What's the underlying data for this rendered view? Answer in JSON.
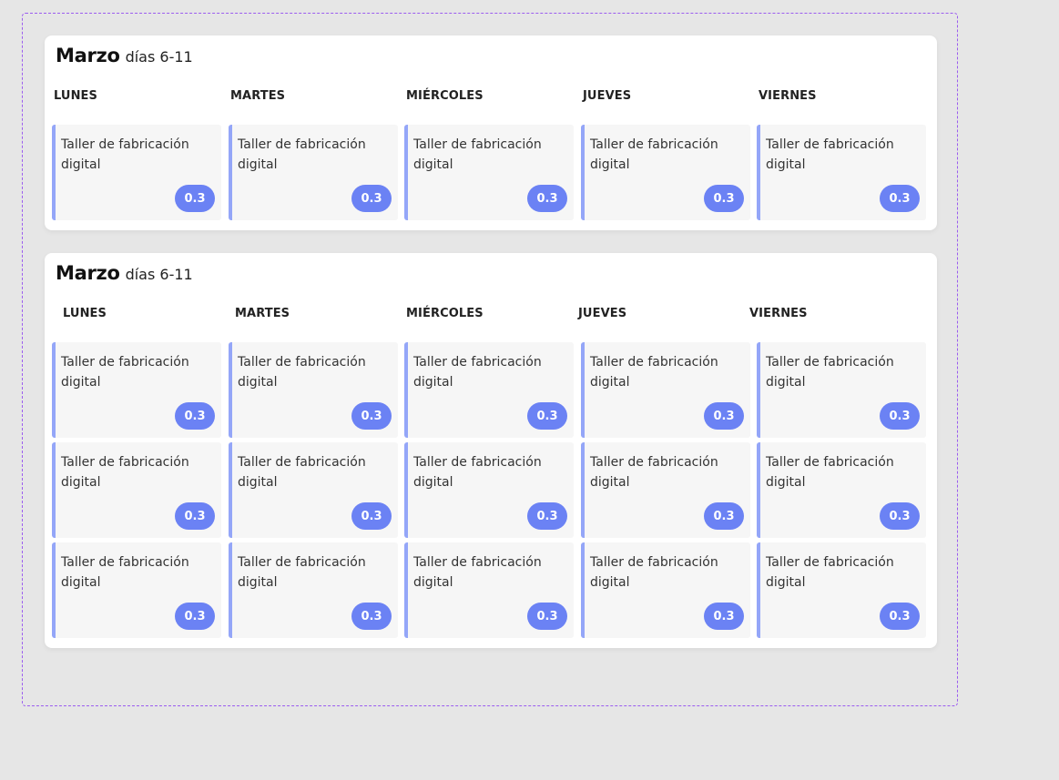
{
  "weeks": [
    {
      "month": "Marzo",
      "range": "días 6-11",
      "days": [
        "LUNES",
        "MARTES",
        "MIÉRCOLES",
        "JUEVES",
        "VIERNES"
      ],
      "rows": [
        [
          {
            "title": "Taller de fabricación digital",
            "badge": "0.3"
          },
          {
            "title": "Taller de fabricación digital",
            "badge": "0.3"
          },
          {
            "title": "Taller de fabricación digital",
            "badge": "0.3"
          },
          {
            "title": "Taller de fabricación digital",
            "badge": "0.3"
          },
          {
            "title": "Taller de fabricación digital",
            "badge": "0.3"
          }
        ]
      ]
    },
    {
      "month": "Marzo",
      "range": "días 6-11",
      "days": [
        "LUNES",
        "MARTES",
        "MIÉRCOLES",
        "JUEVES",
        "VIERNES"
      ],
      "rows": [
        [
          {
            "title": "Taller de fabricación digital",
            "badge": "0.3"
          },
          {
            "title": "Taller de fabricación digital",
            "badge": "0.3"
          },
          {
            "title": "Taller de fabricación digital",
            "badge": "0.3"
          },
          {
            "title": "Taller de fabricación digital",
            "badge": "0.3"
          },
          {
            "title": "Taller de fabricación digital",
            "badge": "0.3"
          }
        ],
        [
          {
            "title": "Taller de fabricación digital",
            "badge": "0.3"
          },
          {
            "title": "Taller de fabricación digital",
            "badge": "0.3"
          },
          {
            "title": "Taller de fabricación digital",
            "badge": "0.3"
          },
          {
            "title": "Taller de fabricación digital",
            "badge": "0.3"
          },
          {
            "title": "Taller de fabricación digital",
            "badge": "0.3"
          }
        ],
        [
          {
            "title": "Taller de fabricación digital",
            "badge": "0.3"
          },
          {
            "title": "Taller de fabricación digital",
            "badge": "0.3"
          },
          {
            "title": "Taller de fabricación digital",
            "badge": "0.3"
          },
          {
            "title": "Taller de fabricación digital",
            "badge": "0.3"
          },
          {
            "title": "Taller de fabricación digital",
            "badge": "0.3"
          }
        ]
      ]
    }
  ],
  "colors": {
    "accent": "#6b82f4",
    "cell_border": "#94a6f8",
    "selection_frame": "#9b5cf0"
  }
}
